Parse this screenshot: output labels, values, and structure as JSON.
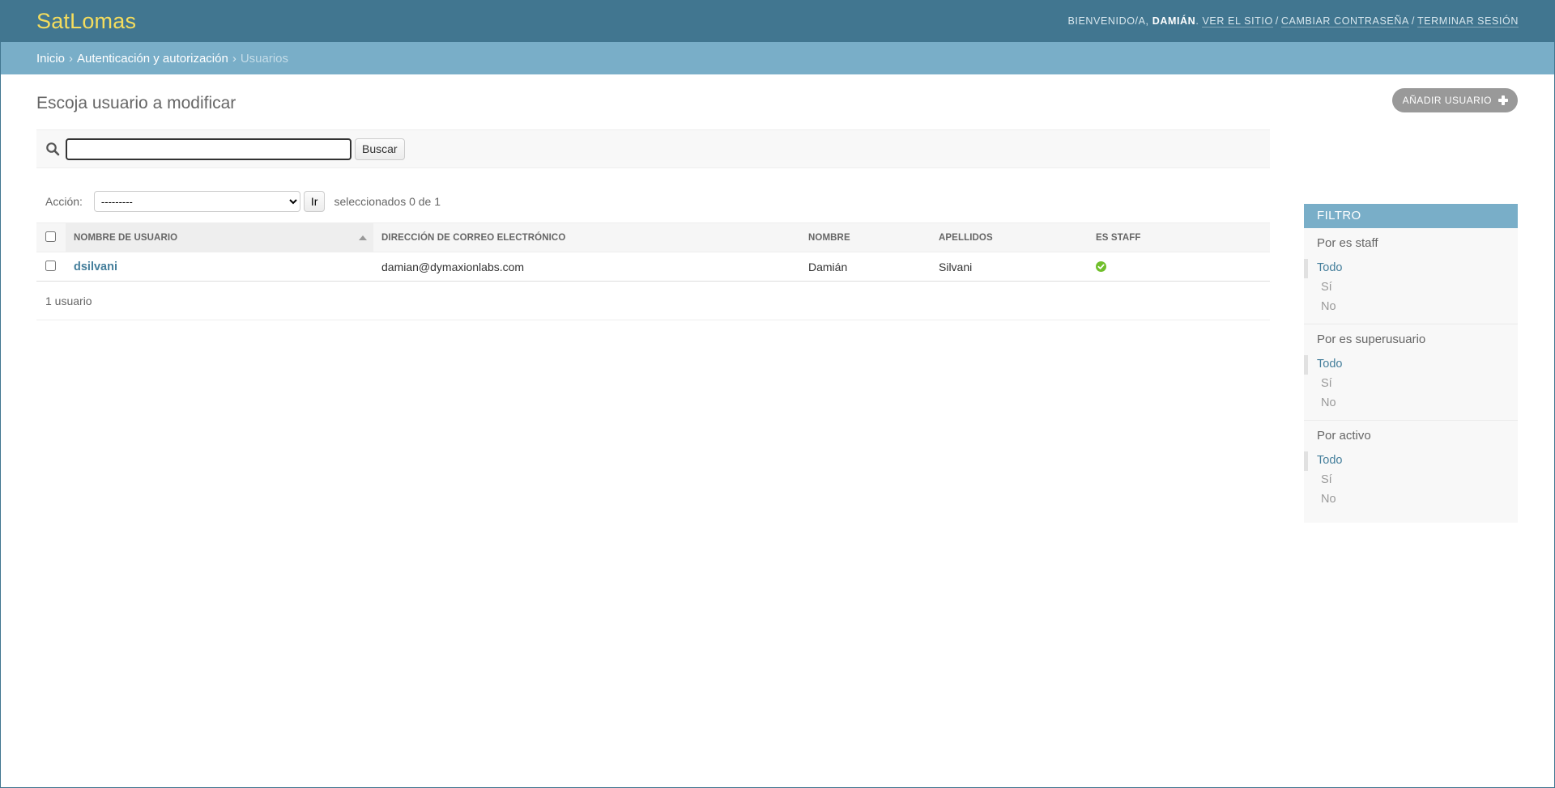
{
  "header": {
    "site_name": "SatLomas",
    "welcome": "Bienvenido/a,",
    "user_name": "Damián",
    "links": [
      "Ver el sitio",
      "Cambiar contraseña",
      "Terminar sesión"
    ]
  },
  "breadcrumbs": {
    "home": "Inicio",
    "app": "Autenticación y autorización",
    "current": "Usuarios"
  },
  "page_title": "Escoja usuario a modificar",
  "add_button": "Añadir usuario",
  "search": {
    "value": "",
    "button": "Buscar"
  },
  "actions": {
    "label": "Acción:",
    "selected": "---------",
    "go": "Ir",
    "counter": "seleccionados 0 de 1"
  },
  "table": {
    "headers": [
      "Nombre de usuario",
      "Dirección de correo electrónico",
      "Nombre",
      "Apellidos",
      "Es staff"
    ],
    "rows": [
      {
        "username": "dsilvani",
        "email": "damian@dymaxionlabs.com",
        "first_name": "Damián",
        "last_name": "Silvani",
        "is_staff": true
      }
    ]
  },
  "paginator": "1 usuario",
  "filter": {
    "title": "Filtro",
    "groups": [
      {
        "title": "Por es staff",
        "options": [
          "Todo",
          "Sí",
          "No"
        ]
      },
      {
        "title": "Por es superusuario",
        "options": [
          "Todo",
          "Sí",
          "No"
        ]
      },
      {
        "title": "Por activo",
        "options": [
          "Todo",
          "Sí",
          "No"
        ]
      }
    ]
  },
  "colors": {
    "header_bg": "#417690",
    "breadcrumb_bg": "#79aec8",
    "brand": "#f5dd5d",
    "link": "#447e9b",
    "staff_icon": "#70bf2b"
  }
}
